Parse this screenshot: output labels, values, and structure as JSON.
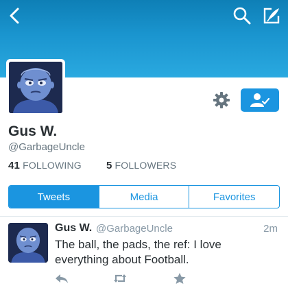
{
  "header": {
    "back_icon": "chevron-left-icon",
    "search_icon": "search-icon",
    "compose_icon": "compose-tweet-icon",
    "gradient_top": "#0e7fb6",
    "gradient_bottom": "#2aa9e0"
  },
  "profile": {
    "name": "Gus W.",
    "handle": "@GarbageUncle",
    "following_count": "41",
    "following_label": "FOLLOWING",
    "followers_count": "5",
    "followers_label": "FOLLOWERS",
    "settings_icon": "gear-icon",
    "follow_icon": "user-check-icon",
    "accent": "#1b95e0"
  },
  "tabs": [
    {
      "label": "Tweets",
      "active": true
    },
    {
      "label": "Media",
      "active": false
    },
    {
      "label": "Favorites",
      "active": false
    }
  ],
  "tweet": {
    "name": "Gus W.",
    "handle": "@GarbageUncle",
    "time": "2m",
    "text": "The ball, the pads, the ref: I love everything about Football.",
    "actions": [
      "reply-icon",
      "retweet-icon",
      "favorite-star-icon"
    ]
  }
}
